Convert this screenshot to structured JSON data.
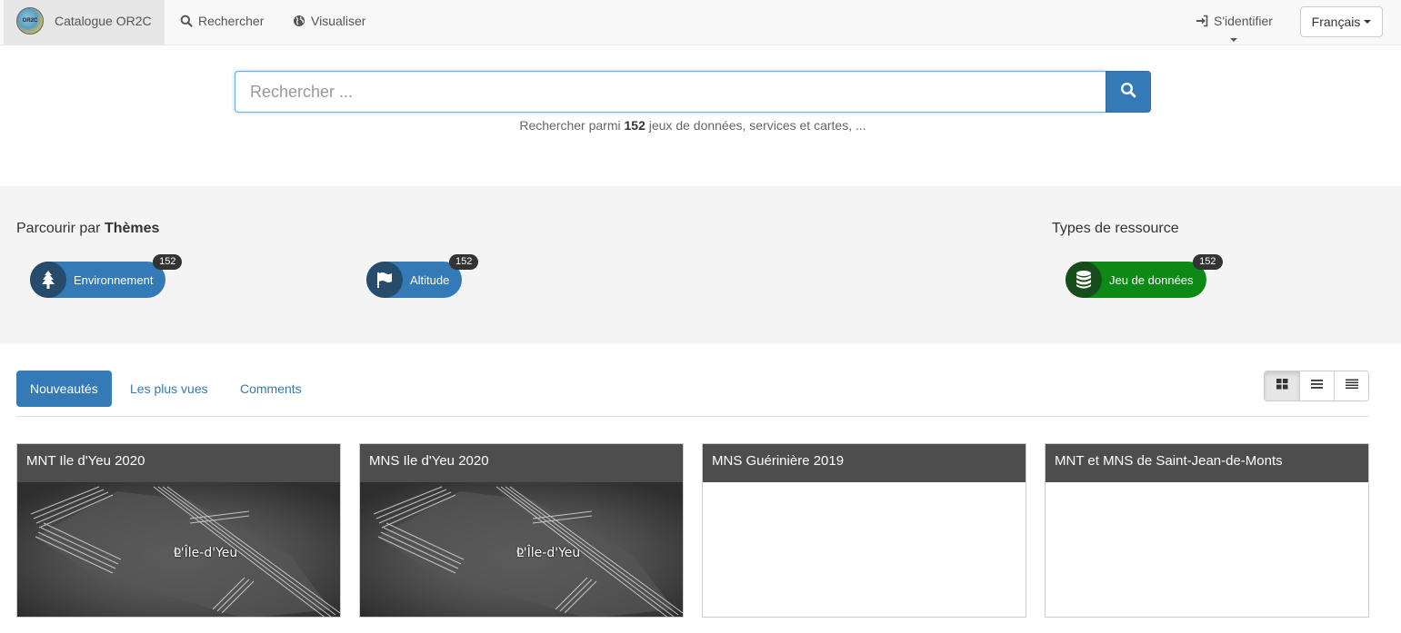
{
  "navbar": {
    "brand_label": "Catalogue OR2C",
    "logo_text": "OR2C",
    "search_label": "Rechercher",
    "visualize_label": "Visualiser",
    "signin_label": "S'identifier",
    "language_label": "Français"
  },
  "search": {
    "placeholder": "Rechercher ...",
    "hint_prefix": "Rechercher parmi",
    "hint_count": "152",
    "hint_suffix": "jeux de données, services et cartes, ..."
  },
  "browse": {
    "themes_prefix": "Parcourir par",
    "themes_strong": "Thèmes",
    "themes": [
      {
        "label": "Environnement",
        "count": "152",
        "icon": "tree-icon"
      },
      {
        "label": "Altitude",
        "count": "152",
        "icon": "flag-icon"
      }
    ],
    "types_title": "Types de ressource",
    "types": [
      {
        "label": "Jeu de données",
        "count": "152",
        "icon": "database-icon"
      }
    ]
  },
  "tabs": [
    {
      "label": "Nouveautés",
      "active": true
    },
    {
      "label": "Les plus vues",
      "active": false
    },
    {
      "label": "Comments",
      "active": false
    }
  ],
  "view_modes": [
    "grid-view-icon",
    "list-view-icon",
    "compact-list-view-icon"
  ],
  "cards": [
    {
      "title": "MNT Ile d'Yeu 2020",
      "has_thumbnail": true,
      "map_label": "L'Île-d'Yeu"
    },
    {
      "title": "MNS Ile d'Yeu 2020",
      "has_thumbnail": true,
      "map_label": "L'Île-d'Yeu"
    },
    {
      "title": "MNS Guérinière 2019",
      "has_thumbnail": false
    },
    {
      "title": "MNT et MNS de Saint-Jean-de-Monts",
      "has_thumbnail": false
    }
  ],
  "colors": {
    "primary": "#337ab7",
    "green": "#0d8a16",
    "card_header": "#4d4d4d"
  }
}
